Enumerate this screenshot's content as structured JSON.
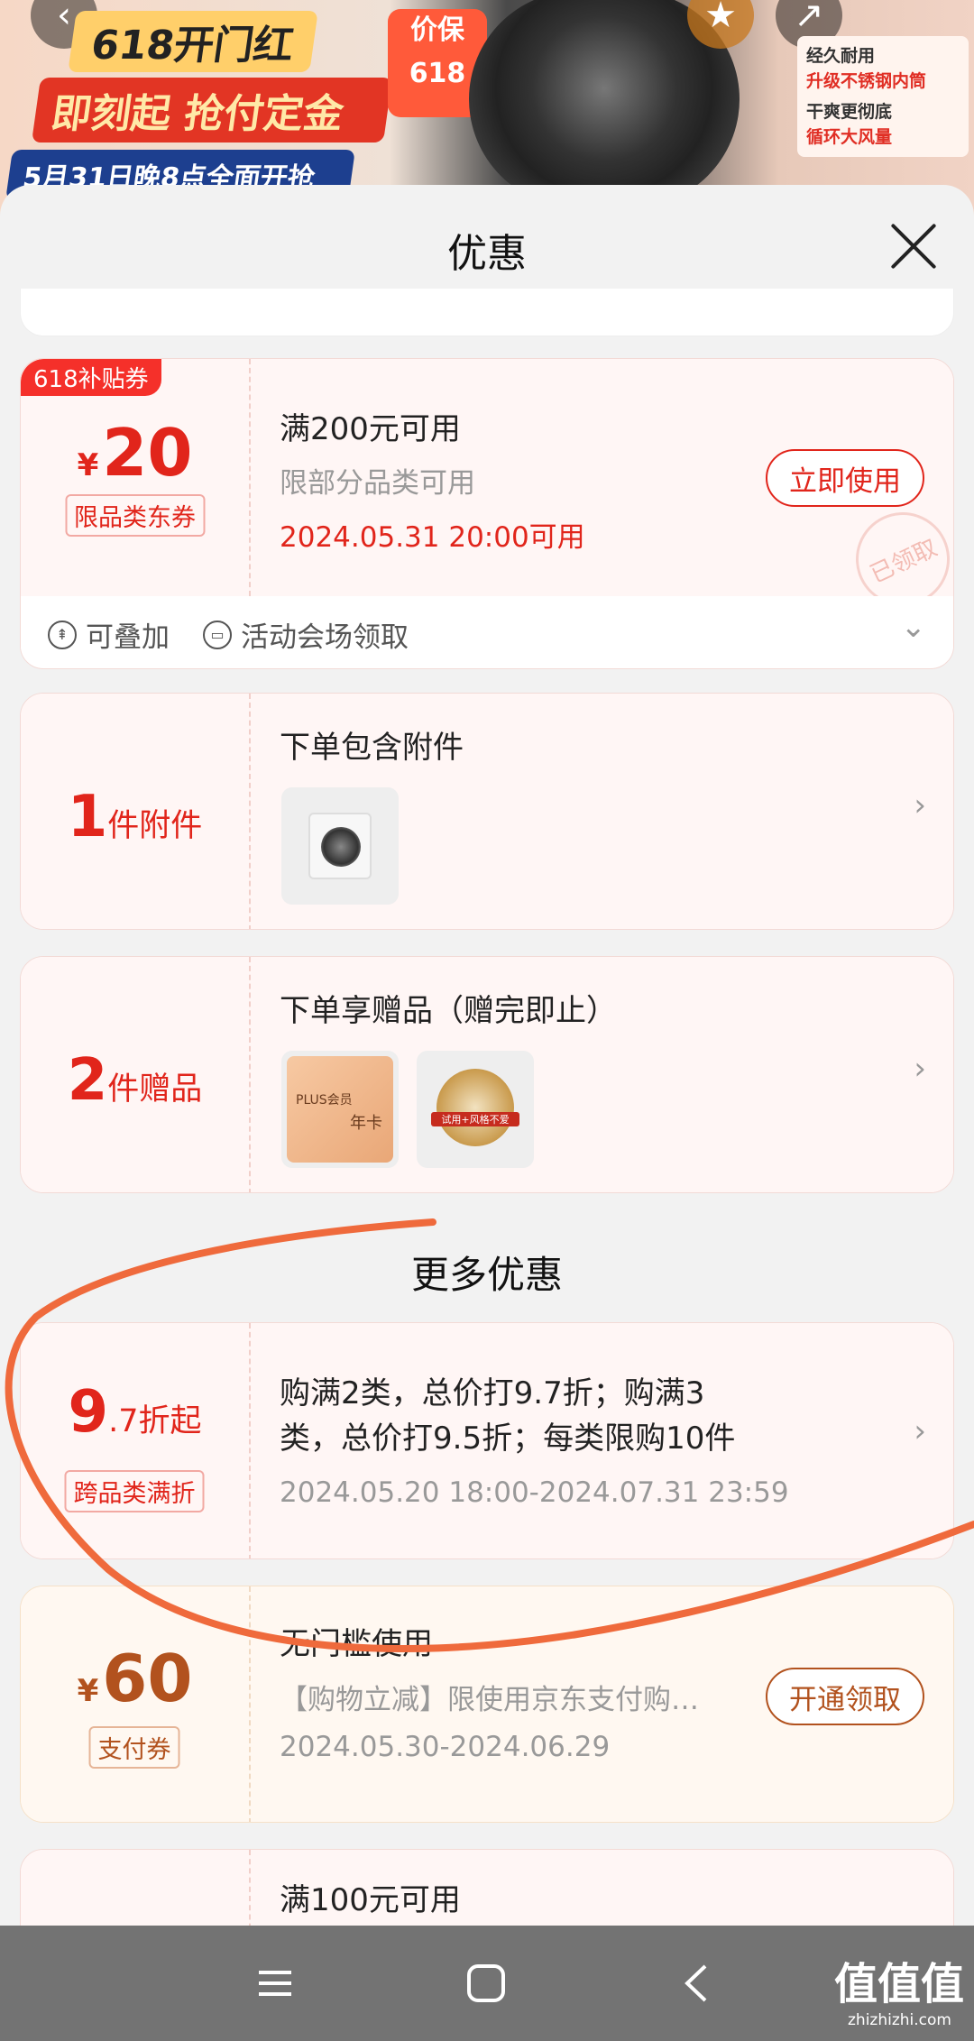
{
  "banner": {
    "promo_line1": "618开门红",
    "promo_line2": "即刻起 抢付定金",
    "promo_line3": "5月31日晚8点全面开抢",
    "price_guard": "价保 618",
    "features": [
      {
        "title": "经久耐用",
        "sub": "升级不锈钢内筒"
      },
      {
        "title": "干爽更彻底",
        "sub": "循环大风量"
      }
    ]
  },
  "sheet": {
    "title": "优惠"
  },
  "coupon_618": {
    "tag": "618补贴券",
    "currency": "¥",
    "amount": "20",
    "type": "限品类东券",
    "title": "满200元可用",
    "sub": "限部分品类可用",
    "time": "2024.05.31 20:00可用",
    "button": "立即使用",
    "stamp": "已领取",
    "foot_stack": "可叠加",
    "foot_source": "活动会场领取"
  },
  "accessory": {
    "count": "1",
    "unit": "件附件",
    "title": "下单包含附件"
  },
  "gift": {
    "count": "2",
    "unit": "件赠品",
    "title": "下单享赠品（赠完即止）",
    "gift1_line1": "PLUS会员",
    "gift1_line2": "年卡",
    "gift2_label": "试用+风格不爱"
  },
  "more": {
    "title": "更多优惠"
  },
  "discount": {
    "big": "9",
    "small": ".7折起",
    "type": "跨品类满折",
    "desc_line1": "购满2类，总价打9.7折；购满3",
    "desc_line2": "类，总价打9.5折；每类限购10件",
    "time": "2024.05.20 18:00-2024.07.31 23:59"
  },
  "pay_coupon": {
    "currency": "¥",
    "amount": "60",
    "type": "支付券",
    "title": "无门槛使用",
    "sub": "【购物立减】限使用京东支付购…",
    "time": "2024.05.30-2024.06.29",
    "button": "开通领取"
  },
  "partial_coupon": {
    "title": "满100元可用"
  },
  "watermark": {
    "text": "值值值",
    "site": "zhizhizhi.com"
  },
  "colors": {
    "accent_red": "#e1251b",
    "annotation_stroke": "#ef6a3c"
  }
}
